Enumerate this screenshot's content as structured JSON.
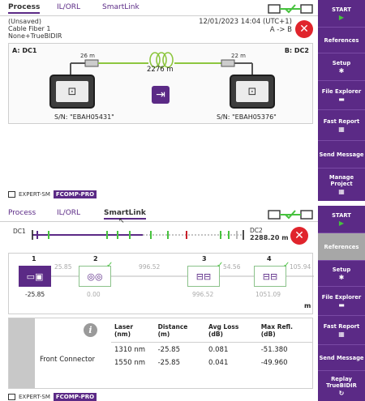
{
  "screen1": {
    "tabs": [
      "Process",
      "IL/ORL",
      "SmartLink"
    ],
    "active_tab": "Process",
    "status": "(Unsaved)",
    "cable": "Cable Fiber 1",
    "mode": "None+TrueBIDIR",
    "datetime": "12/01/2023 14:04 (UTC+1)",
    "direction": "A -> B",
    "dc_a": "A: DC1",
    "dc_b": "B: DC2",
    "launch_a": "26 m",
    "launch_b": "22 m",
    "fiber_length": "2276 m",
    "sn_a": "S/N: \"EBAH05431\"",
    "sn_b": "S/N: \"EBAH05376\"",
    "side_buttons": [
      {
        "label": "START",
        "icon": "play-icon"
      },
      {
        "label": "References",
        "icon": ""
      },
      {
        "label": "Setup",
        "icon": "gear-icon"
      },
      {
        "label": "File Explorer",
        "icon": "folder-icon"
      },
      {
        "label": "Fast Report",
        "icon": "report-icon"
      },
      {
        "label": "Send Message",
        "icon": ""
      },
      {
        "label": "Manage Project",
        "icon": "project-icon"
      }
    ],
    "footer_left": "EXPERT-SM",
    "footer_right": "FCOMP-PRO"
  },
  "screen2": {
    "tabs": [
      "Process",
      "IL/ORL",
      "SmartLink"
    ],
    "active_tab": "SmartLink",
    "dc1": "DC1",
    "dc2": "DC2",
    "total_length": "2288.20 m",
    "events": [
      {
        "num": "1",
        "value": "-25.85",
        "type": "connector"
      },
      {
        "num": "2",
        "value": "0.00",
        "type": "fiber-coil"
      },
      {
        "num": "3",
        "value": "996.52",
        "type": "splice"
      },
      {
        "num": "4",
        "value": "1051.09",
        "type": "splice"
      }
    ],
    "spans": [
      "25.85",
      "996.52",
      "54.56",
      "105.94"
    ],
    "unit": "m",
    "selected_event": "Front Connector",
    "table": {
      "headers": [
        "Laser (nm)",
        "Distance (m)",
        "Avg Loss (dB)",
        "Max Refl. (dB)"
      ],
      "rows": [
        [
          "1310 nm",
          "-25.85",
          "0.081",
          "-51.380"
        ],
        [
          "1550 nm",
          "-25.85",
          "0.041",
          "-49.960"
        ]
      ]
    },
    "side_buttons": [
      {
        "label": "START",
        "icon": "play-icon"
      },
      {
        "label": "References",
        "icon": ""
      },
      {
        "label": "Setup",
        "icon": "gear-icon"
      },
      {
        "label": "File Explorer",
        "icon": "folder-icon"
      },
      {
        "label": "Fast Report",
        "icon": "report-icon"
      },
      {
        "label": "Send Message",
        "icon": ""
      },
      {
        "label": "Replay TrueBIDIR",
        "icon": "replay-icon"
      }
    ],
    "footer_left": "EXPERT-SM",
    "footer_right": "FCOMP-PRO"
  },
  "colors": {
    "brand_purple": "#5b2a86",
    "accent_green": "#47c23e",
    "fiber_green": "#8dc63f",
    "close_red": "#e0242c",
    "fault_red": "#c8202a"
  }
}
